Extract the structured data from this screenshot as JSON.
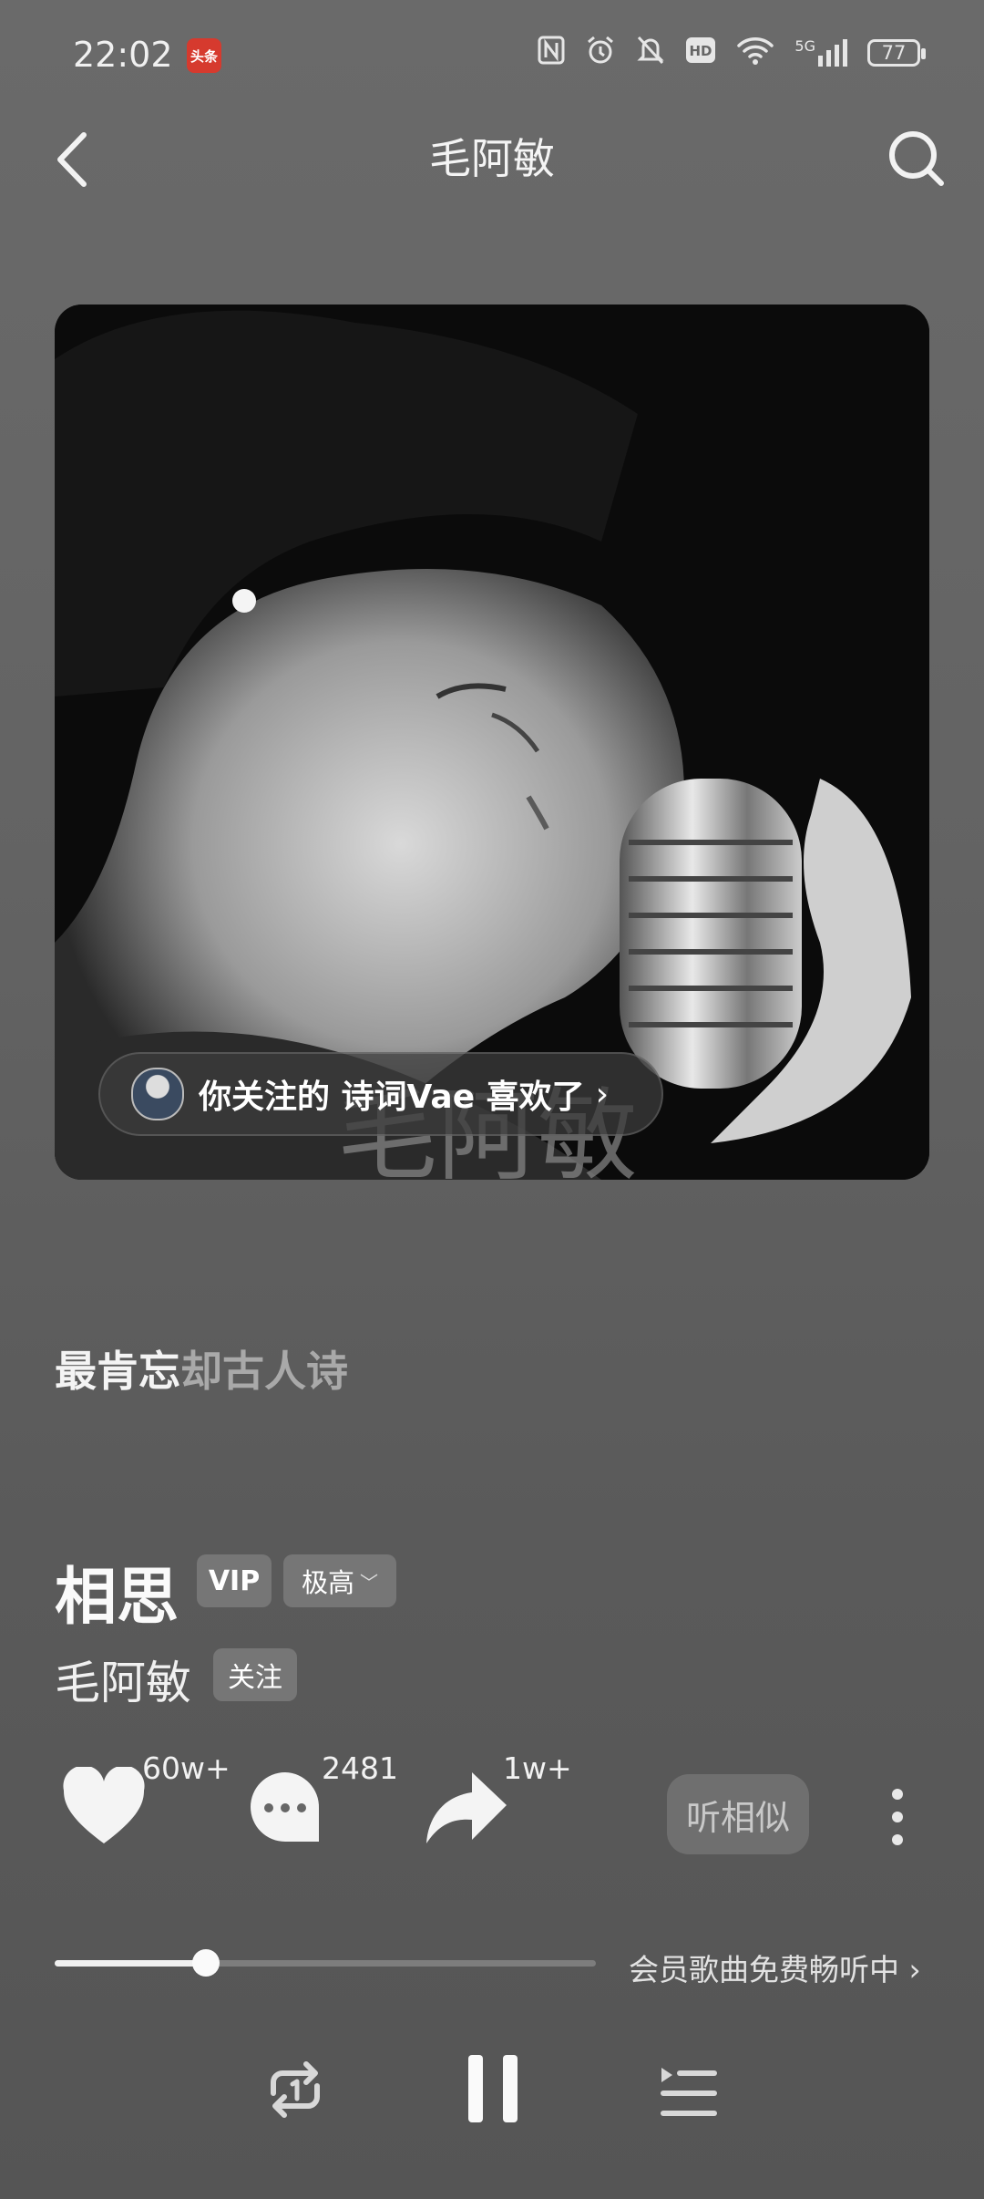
{
  "status_bar": {
    "time": "22:02",
    "app_badge": "头条",
    "network": "5G",
    "battery": "77"
  },
  "header": {
    "title": "毛阿敏"
  },
  "cover": {
    "artist_watermark": "毛阿敏"
  },
  "friend_like": {
    "text": "你关注的 诗词Vae 喜欢了"
  },
  "lyric": {
    "sung": "最肯忘",
    "unsung": "却古人诗"
  },
  "song": {
    "title": "相思",
    "vip_badge": "VIP",
    "quality": "极高",
    "artist": "毛阿敏",
    "follow_label": "关注"
  },
  "actions": {
    "like_count": "60w+",
    "comment_count": "2481",
    "share_count": "1w+",
    "similar_label": "听相似"
  },
  "progress": {
    "played_fraction": 0.28,
    "vip_text": "会员歌曲免费畅听中"
  },
  "colors": {
    "background": "#636363",
    "accent": "#f0f0f0"
  },
  "icons": [
    "back-icon",
    "search-icon",
    "heart-icon",
    "comment-icon",
    "share-icon",
    "more-icon",
    "repeat-icon",
    "pause-icon",
    "playlist-icon"
  ]
}
